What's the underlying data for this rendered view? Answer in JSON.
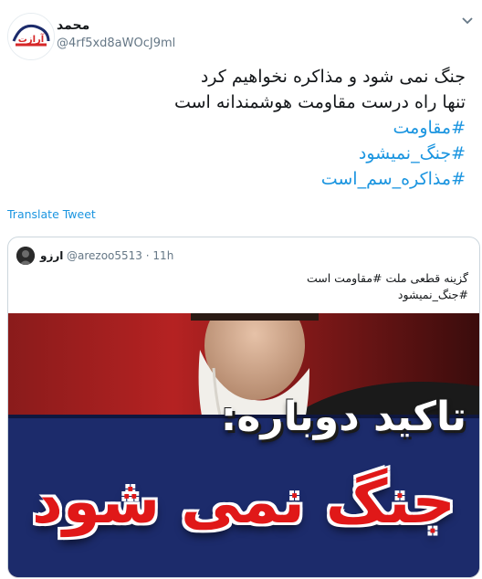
{
  "author": {
    "display_name": "محمد",
    "handle": "@4rf5xd8aWOcJ9ml",
    "avatar_icon": "araz-logo-avatar",
    "avatar_logo_text": "آرازت"
  },
  "tweet": {
    "lines": [
      "جنگ نمی شود و مذاکره نخواهیم کرد",
      "تنها راه درست مقاومت هوشمندانه است"
    ],
    "hashtags": [
      "#مقاومت",
      "#جنگ_نمیشود",
      "#مذاکره_سم_است"
    ],
    "translate_label": "Translate Tweet"
  },
  "quoted": {
    "display_name": "ارزو",
    "handle": "@arezoo5513",
    "separator": "·",
    "time": "11h",
    "lines": [
      "گزینه قطعی ملت #مقاومت است",
      "#جنگ_نمیشود"
    ],
    "media": {
      "headline_top": "تاکید دوباره:",
      "headline_main": "جنگ نمی شود"
    }
  },
  "colors": {
    "link": "#1b95e0",
    "text": "#14171a",
    "muted": "#657786",
    "border": "#ccd6dd",
    "banner": "#1c2b6b",
    "headline_red": "#e01818"
  }
}
